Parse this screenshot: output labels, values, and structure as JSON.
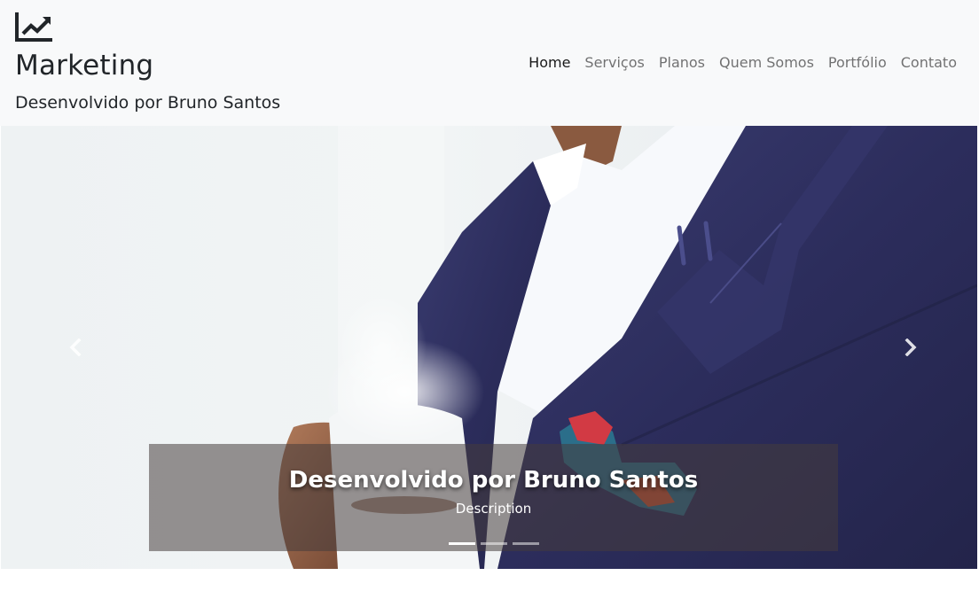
{
  "brand": {
    "icon": "chart-line-icon",
    "title": "Marketing",
    "subtitle": "Desenvolvido por Bruno Santos"
  },
  "nav": {
    "items": [
      {
        "label": "Home",
        "active": true
      },
      {
        "label": "Serviços",
        "active": false
      },
      {
        "label": "Planos",
        "active": false
      },
      {
        "label": "Quem Somos",
        "active": false
      },
      {
        "label": "Portfólio",
        "active": false
      },
      {
        "label": "Contato",
        "active": false
      }
    ]
  },
  "carousel": {
    "image": "businessman-suit-coffee-cup",
    "caption": {
      "title": "Desenvolvido por Bruno Santos",
      "description": "Description"
    },
    "slide_count": 3,
    "active_slide": 1,
    "prev_icon": "chevron-left-icon",
    "next_icon": "chevron-right-icon"
  },
  "colors": {
    "navbar_bg": "#f8f9fa",
    "suit": "#2d2f5e",
    "caption_bg": "rgba(70,60,60,0.55)"
  }
}
